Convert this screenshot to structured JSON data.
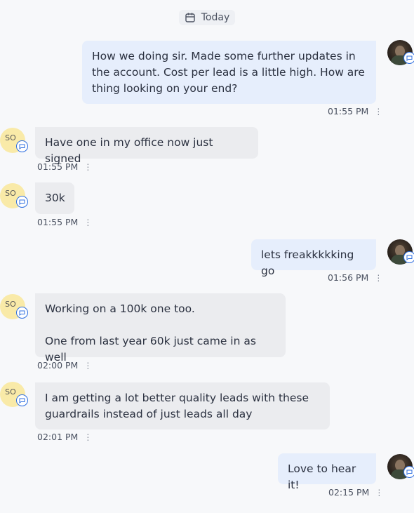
{
  "date_label": "Today",
  "messages": [
    {
      "from": "me",
      "text": "How we doing sir. Made some further updates in the account. Cost per lead is a little high. How are thing looking on your end?",
      "time": "01:55 PM"
    },
    {
      "from": "so",
      "avatar_initials": "SO",
      "text": "Have one in my office now just signed",
      "time": "01:55 PM"
    },
    {
      "from": "so",
      "avatar_initials": "SO",
      "text": "30k",
      "time": "01:55 PM"
    },
    {
      "from": "me",
      "text": "lets freakkkkking go",
      "time": "01:56 PM"
    },
    {
      "from": "so",
      "avatar_initials": "SO",
      "text_line1": "Working on a 100k one too.",
      "text_line2": "One from last year 60k just came in as well",
      "time": "02:00 PM"
    },
    {
      "from": "so",
      "avatar_initials": "SO",
      "text": "I am getting a lot better quality leads with these guardrails instead of just leads all day",
      "time": "02:01 PM"
    },
    {
      "from": "me",
      "text": "Love to hear it!",
      "time": "02:15 PM"
    }
  ],
  "kebab_glyph": "⋮",
  "icons": {
    "date": "calendar-icon",
    "badge": "chat-bubble-icon",
    "more": "kebab-menu-icon"
  },
  "colors": {
    "outgoing_bubble": "#e6eefc",
    "incoming_bubble": "#ebecef",
    "avatar_so": "#f9eaa8",
    "badge_border": "#2f6fe0"
  }
}
